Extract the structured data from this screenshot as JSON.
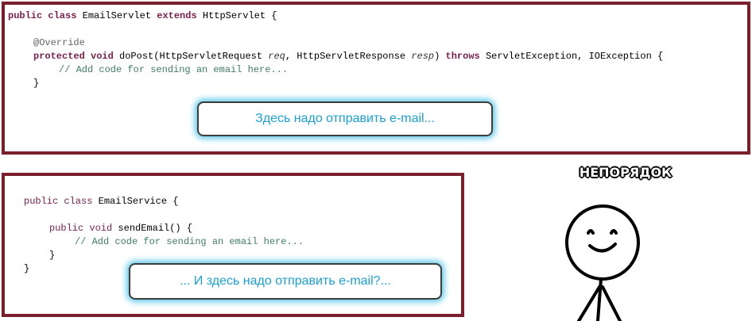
{
  "panel1": {
    "line1": {
      "kw1": "public class",
      "mid": " EmailServlet ",
      "kw2": "extends",
      "rest": " HttpServlet {"
    },
    "line2": {
      "ann": "@Override"
    },
    "line3": {
      "kw": "protected void",
      "p1": " doPost(HttpServletRequest ",
      "a1": "req",
      "p2": ", HttpServletResponse ",
      "a2": "resp",
      "p3": ") ",
      "kw2": "throws",
      "p4": " ServletException, IOException {"
    },
    "line4": {
      "comment": "// Add code for sending an email here..."
    },
    "line5": {
      "text": "}"
    }
  },
  "callout1": {
    "text": "Здесь надо отправить e-mail..."
  },
  "panel2": {
    "line1": {
      "kw": "public class",
      "rest": " EmailService {"
    },
    "line2": {
      "kw": "public void",
      "rest": " sendEmail() {"
    },
    "line3": {
      "comment": "// Add code for sending an email here..."
    },
    "line4": {
      "text": "}"
    },
    "line5": {
      "text": "}"
    }
  },
  "callout2": {
    "text": "... И здесь надо отправить e-mail?..."
  },
  "meme": {
    "title": "НЕПОРЯДОК"
  }
}
